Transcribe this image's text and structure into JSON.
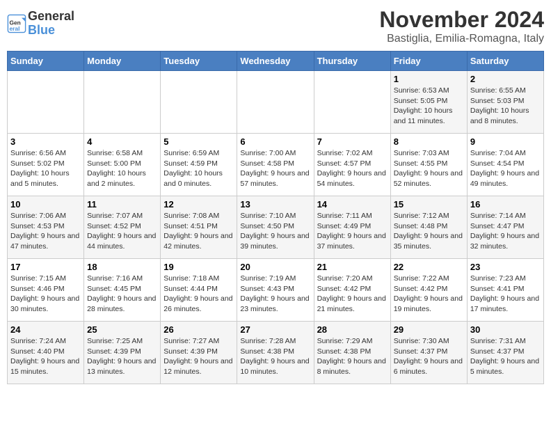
{
  "header": {
    "logo_line1": "General",
    "logo_line2": "Blue",
    "month": "November 2024",
    "location": "Bastiglia, Emilia-Romagna, Italy"
  },
  "days_of_week": [
    "Sunday",
    "Monday",
    "Tuesday",
    "Wednesday",
    "Thursday",
    "Friday",
    "Saturday"
  ],
  "weeks": [
    [
      {
        "day": "",
        "info": ""
      },
      {
        "day": "",
        "info": ""
      },
      {
        "day": "",
        "info": ""
      },
      {
        "day": "",
        "info": ""
      },
      {
        "day": "",
        "info": ""
      },
      {
        "day": "1",
        "info": "Sunrise: 6:53 AM\nSunset: 5:05 PM\nDaylight: 10 hours and 11 minutes."
      },
      {
        "day": "2",
        "info": "Sunrise: 6:55 AM\nSunset: 5:03 PM\nDaylight: 10 hours and 8 minutes."
      }
    ],
    [
      {
        "day": "3",
        "info": "Sunrise: 6:56 AM\nSunset: 5:02 PM\nDaylight: 10 hours and 5 minutes."
      },
      {
        "day": "4",
        "info": "Sunrise: 6:58 AM\nSunset: 5:00 PM\nDaylight: 10 hours and 2 minutes."
      },
      {
        "day": "5",
        "info": "Sunrise: 6:59 AM\nSunset: 4:59 PM\nDaylight: 10 hours and 0 minutes."
      },
      {
        "day": "6",
        "info": "Sunrise: 7:00 AM\nSunset: 4:58 PM\nDaylight: 9 hours and 57 minutes."
      },
      {
        "day": "7",
        "info": "Sunrise: 7:02 AM\nSunset: 4:57 PM\nDaylight: 9 hours and 54 minutes."
      },
      {
        "day": "8",
        "info": "Sunrise: 7:03 AM\nSunset: 4:55 PM\nDaylight: 9 hours and 52 minutes."
      },
      {
        "day": "9",
        "info": "Sunrise: 7:04 AM\nSunset: 4:54 PM\nDaylight: 9 hours and 49 minutes."
      }
    ],
    [
      {
        "day": "10",
        "info": "Sunrise: 7:06 AM\nSunset: 4:53 PM\nDaylight: 9 hours and 47 minutes."
      },
      {
        "day": "11",
        "info": "Sunrise: 7:07 AM\nSunset: 4:52 PM\nDaylight: 9 hours and 44 minutes."
      },
      {
        "day": "12",
        "info": "Sunrise: 7:08 AM\nSunset: 4:51 PM\nDaylight: 9 hours and 42 minutes."
      },
      {
        "day": "13",
        "info": "Sunrise: 7:10 AM\nSunset: 4:50 PM\nDaylight: 9 hours and 39 minutes."
      },
      {
        "day": "14",
        "info": "Sunrise: 7:11 AM\nSunset: 4:49 PM\nDaylight: 9 hours and 37 minutes."
      },
      {
        "day": "15",
        "info": "Sunrise: 7:12 AM\nSunset: 4:48 PM\nDaylight: 9 hours and 35 minutes."
      },
      {
        "day": "16",
        "info": "Sunrise: 7:14 AM\nSunset: 4:47 PM\nDaylight: 9 hours and 32 minutes."
      }
    ],
    [
      {
        "day": "17",
        "info": "Sunrise: 7:15 AM\nSunset: 4:46 PM\nDaylight: 9 hours and 30 minutes."
      },
      {
        "day": "18",
        "info": "Sunrise: 7:16 AM\nSunset: 4:45 PM\nDaylight: 9 hours and 28 minutes."
      },
      {
        "day": "19",
        "info": "Sunrise: 7:18 AM\nSunset: 4:44 PM\nDaylight: 9 hours and 26 minutes."
      },
      {
        "day": "20",
        "info": "Sunrise: 7:19 AM\nSunset: 4:43 PM\nDaylight: 9 hours and 23 minutes."
      },
      {
        "day": "21",
        "info": "Sunrise: 7:20 AM\nSunset: 4:42 PM\nDaylight: 9 hours and 21 minutes."
      },
      {
        "day": "22",
        "info": "Sunrise: 7:22 AM\nSunset: 4:42 PM\nDaylight: 9 hours and 19 minutes."
      },
      {
        "day": "23",
        "info": "Sunrise: 7:23 AM\nSunset: 4:41 PM\nDaylight: 9 hours and 17 minutes."
      }
    ],
    [
      {
        "day": "24",
        "info": "Sunrise: 7:24 AM\nSunset: 4:40 PM\nDaylight: 9 hours and 15 minutes."
      },
      {
        "day": "25",
        "info": "Sunrise: 7:25 AM\nSunset: 4:39 PM\nDaylight: 9 hours and 13 minutes."
      },
      {
        "day": "26",
        "info": "Sunrise: 7:27 AM\nSunset: 4:39 PM\nDaylight: 9 hours and 12 minutes."
      },
      {
        "day": "27",
        "info": "Sunrise: 7:28 AM\nSunset: 4:38 PM\nDaylight: 9 hours and 10 minutes."
      },
      {
        "day": "28",
        "info": "Sunrise: 7:29 AM\nSunset: 4:38 PM\nDaylight: 9 hours and 8 minutes."
      },
      {
        "day": "29",
        "info": "Sunrise: 7:30 AM\nSunset: 4:37 PM\nDaylight: 9 hours and 6 minutes."
      },
      {
        "day": "30",
        "info": "Sunrise: 7:31 AM\nSunset: 4:37 PM\nDaylight: 9 hours and 5 minutes."
      }
    ]
  ]
}
